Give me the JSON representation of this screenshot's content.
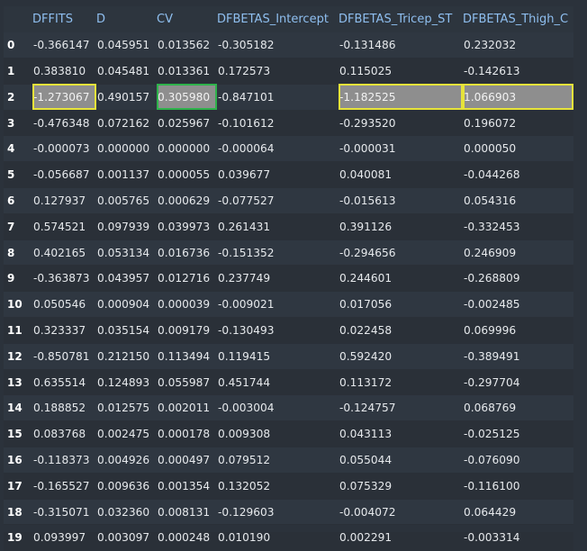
{
  "table": {
    "columns": [
      "",
      "DFFITS",
      "D",
      "CV",
      "DFBETAS_Intercept",
      "DFBETAS_Tricep_ST",
      "DFBETAS_Thigh_C"
    ],
    "rows": [
      {
        "index": "0",
        "cells": [
          "-0.366147",
          "0.045951",
          "0.013562",
          "-0.305182",
          "-0.131486",
          "0.232032"
        ]
      },
      {
        "index": "1",
        "cells": [
          "0.383810",
          "0.045481",
          "0.013361",
          "0.172573",
          "0.115025",
          "-0.142613"
        ]
      },
      {
        "index": "2",
        "cells": [
          "-1.273067",
          "0.490157",
          "0.305980",
          "-0.847101",
          "-1.182525",
          "1.066903"
        ],
        "highlights": {
          "0": "yellow",
          "2": "green",
          "4": "yellow",
          "5": "yellow"
        }
      },
      {
        "index": "3",
        "cells": [
          "-0.476348",
          "0.072162",
          "0.025967",
          "-0.101612",
          "-0.293520",
          "0.196072"
        ]
      },
      {
        "index": "4",
        "cells": [
          "-0.000073",
          "0.000000",
          "0.000000",
          "-0.000064",
          "-0.000031",
          "0.000050"
        ]
      },
      {
        "index": "5",
        "cells": [
          "-0.056687",
          "0.001137",
          "0.000055",
          "0.039677",
          "0.040081",
          "-0.044268"
        ]
      },
      {
        "index": "6",
        "cells": [
          "0.127937",
          "0.005765",
          "0.000629",
          "-0.077527",
          "-0.015613",
          "0.054316"
        ]
      },
      {
        "index": "7",
        "cells": [
          "0.574521",
          "0.097939",
          "0.039973",
          "0.261431",
          "0.391126",
          "-0.332453"
        ]
      },
      {
        "index": "8",
        "cells": [
          "0.402165",
          "0.053134",
          "0.016736",
          "-0.151352",
          "-0.294656",
          "0.246909"
        ]
      },
      {
        "index": "9",
        "cells": [
          "-0.363873",
          "0.043957",
          "0.012716",
          "0.237749",
          "0.244601",
          "-0.268809"
        ]
      },
      {
        "index": "10",
        "cells": [
          "0.050546",
          "0.000904",
          "0.000039",
          "-0.009021",
          "0.017056",
          "-0.002485"
        ]
      },
      {
        "index": "11",
        "cells": [
          "0.323337",
          "0.035154",
          "0.009179",
          "-0.130493",
          "0.022458",
          "0.069996"
        ]
      },
      {
        "index": "12",
        "cells": [
          "-0.850781",
          "0.212150",
          "0.113494",
          "0.119415",
          "0.592420",
          "-0.389491"
        ]
      },
      {
        "index": "13",
        "cells": [
          "0.635514",
          "0.124893",
          "0.055987",
          "0.451744",
          "0.113172",
          "-0.297704"
        ]
      },
      {
        "index": "14",
        "cells": [
          "0.188852",
          "0.012575",
          "0.002011",
          "-0.003004",
          "-0.124757",
          "0.068769"
        ]
      },
      {
        "index": "15",
        "cells": [
          "0.083768",
          "0.002475",
          "0.000178",
          "0.009308",
          "0.043113",
          "-0.025125"
        ]
      },
      {
        "index": "16",
        "cells": [
          "-0.118373",
          "0.004926",
          "0.000497",
          "0.079512",
          "0.055044",
          "-0.076090"
        ]
      },
      {
        "index": "17",
        "cells": [
          "-0.165527",
          "0.009636",
          "0.001354",
          "0.132052",
          "0.075329",
          "-0.116100"
        ]
      },
      {
        "index": "18",
        "cells": [
          "-0.315071",
          "0.032360",
          "0.008131",
          "-0.129603",
          "-0.004072",
          "0.064429"
        ]
      },
      {
        "index": "19",
        "cells": [
          "0.093997",
          "0.003097",
          "0.000248",
          "0.010190",
          "0.002291",
          "-0.003314"
        ]
      }
    ]
  },
  "colors": {
    "header_text": "#8fbff0",
    "highlight_yellow": "#e6e33a",
    "highlight_green": "#2fb24c",
    "highlight_fill": "#8e8e8e"
  }
}
